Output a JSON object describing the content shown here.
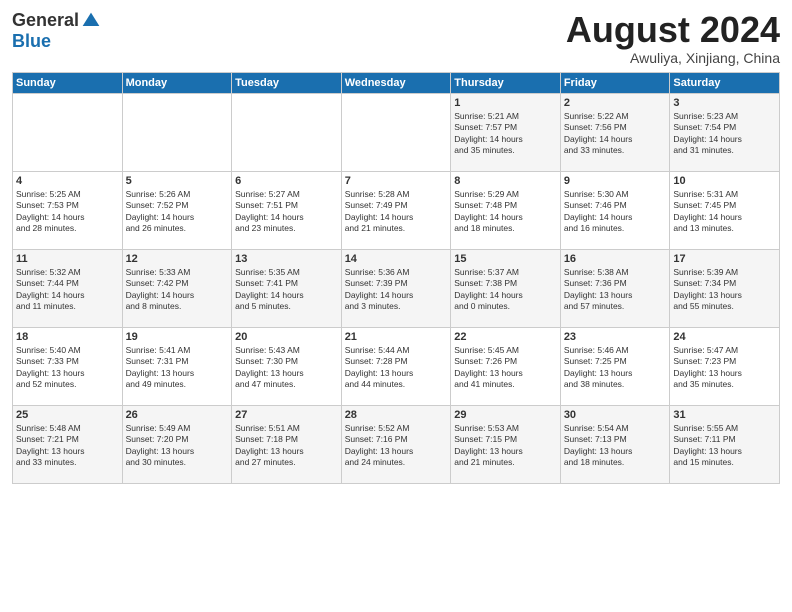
{
  "logo": {
    "general": "General",
    "blue": "Blue"
  },
  "header": {
    "month": "August 2024",
    "location": "Awuliya, Xinjiang, China"
  },
  "days_of_week": [
    "Sunday",
    "Monday",
    "Tuesday",
    "Wednesday",
    "Thursday",
    "Friday",
    "Saturday"
  ],
  "weeks": [
    [
      {
        "day": "",
        "detail": ""
      },
      {
        "day": "",
        "detail": ""
      },
      {
        "day": "",
        "detail": ""
      },
      {
        "day": "",
        "detail": ""
      },
      {
        "day": "1",
        "detail": "Sunrise: 5:21 AM\nSunset: 7:57 PM\nDaylight: 14 hours\nand 35 minutes."
      },
      {
        "day": "2",
        "detail": "Sunrise: 5:22 AM\nSunset: 7:56 PM\nDaylight: 14 hours\nand 33 minutes."
      },
      {
        "day": "3",
        "detail": "Sunrise: 5:23 AM\nSunset: 7:54 PM\nDaylight: 14 hours\nand 31 minutes."
      }
    ],
    [
      {
        "day": "4",
        "detail": "Sunrise: 5:25 AM\nSunset: 7:53 PM\nDaylight: 14 hours\nand 28 minutes."
      },
      {
        "day": "5",
        "detail": "Sunrise: 5:26 AM\nSunset: 7:52 PM\nDaylight: 14 hours\nand 26 minutes."
      },
      {
        "day": "6",
        "detail": "Sunrise: 5:27 AM\nSunset: 7:51 PM\nDaylight: 14 hours\nand 23 minutes."
      },
      {
        "day": "7",
        "detail": "Sunrise: 5:28 AM\nSunset: 7:49 PM\nDaylight: 14 hours\nand 21 minutes."
      },
      {
        "day": "8",
        "detail": "Sunrise: 5:29 AM\nSunset: 7:48 PM\nDaylight: 14 hours\nand 18 minutes."
      },
      {
        "day": "9",
        "detail": "Sunrise: 5:30 AM\nSunset: 7:46 PM\nDaylight: 14 hours\nand 16 minutes."
      },
      {
        "day": "10",
        "detail": "Sunrise: 5:31 AM\nSunset: 7:45 PM\nDaylight: 14 hours\nand 13 minutes."
      }
    ],
    [
      {
        "day": "11",
        "detail": "Sunrise: 5:32 AM\nSunset: 7:44 PM\nDaylight: 14 hours\nand 11 minutes."
      },
      {
        "day": "12",
        "detail": "Sunrise: 5:33 AM\nSunset: 7:42 PM\nDaylight: 14 hours\nand 8 minutes."
      },
      {
        "day": "13",
        "detail": "Sunrise: 5:35 AM\nSunset: 7:41 PM\nDaylight: 14 hours\nand 5 minutes."
      },
      {
        "day": "14",
        "detail": "Sunrise: 5:36 AM\nSunset: 7:39 PM\nDaylight: 14 hours\nand 3 minutes."
      },
      {
        "day": "15",
        "detail": "Sunrise: 5:37 AM\nSunset: 7:38 PM\nDaylight: 14 hours\nand 0 minutes."
      },
      {
        "day": "16",
        "detail": "Sunrise: 5:38 AM\nSunset: 7:36 PM\nDaylight: 13 hours\nand 57 minutes."
      },
      {
        "day": "17",
        "detail": "Sunrise: 5:39 AM\nSunset: 7:34 PM\nDaylight: 13 hours\nand 55 minutes."
      }
    ],
    [
      {
        "day": "18",
        "detail": "Sunrise: 5:40 AM\nSunset: 7:33 PM\nDaylight: 13 hours\nand 52 minutes."
      },
      {
        "day": "19",
        "detail": "Sunrise: 5:41 AM\nSunset: 7:31 PM\nDaylight: 13 hours\nand 49 minutes."
      },
      {
        "day": "20",
        "detail": "Sunrise: 5:43 AM\nSunset: 7:30 PM\nDaylight: 13 hours\nand 47 minutes."
      },
      {
        "day": "21",
        "detail": "Sunrise: 5:44 AM\nSunset: 7:28 PM\nDaylight: 13 hours\nand 44 minutes."
      },
      {
        "day": "22",
        "detail": "Sunrise: 5:45 AM\nSunset: 7:26 PM\nDaylight: 13 hours\nand 41 minutes."
      },
      {
        "day": "23",
        "detail": "Sunrise: 5:46 AM\nSunset: 7:25 PM\nDaylight: 13 hours\nand 38 minutes."
      },
      {
        "day": "24",
        "detail": "Sunrise: 5:47 AM\nSunset: 7:23 PM\nDaylight: 13 hours\nand 35 minutes."
      }
    ],
    [
      {
        "day": "25",
        "detail": "Sunrise: 5:48 AM\nSunset: 7:21 PM\nDaylight: 13 hours\nand 33 minutes."
      },
      {
        "day": "26",
        "detail": "Sunrise: 5:49 AM\nSunset: 7:20 PM\nDaylight: 13 hours\nand 30 minutes."
      },
      {
        "day": "27",
        "detail": "Sunrise: 5:51 AM\nSunset: 7:18 PM\nDaylight: 13 hours\nand 27 minutes."
      },
      {
        "day": "28",
        "detail": "Sunrise: 5:52 AM\nSunset: 7:16 PM\nDaylight: 13 hours\nand 24 minutes."
      },
      {
        "day": "29",
        "detail": "Sunrise: 5:53 AM\nSunset: 7:15 PM\nDaylight: 13 hours\nand 21 minutes."
      },
      {
        "day": "30",
        "detail": "Sunrise: 5:54 AM\nSunset: 7:13 PM\nDaylight: 13 hours\nand 18 minutes."
      },
      {
        "day": "31",
        "detail": "Sunrise: 5:55 AM\nSunset: 7:11 PM\nDaylight: 13 hours\nand 15 minutes."
      }
    ]
  ]
}
